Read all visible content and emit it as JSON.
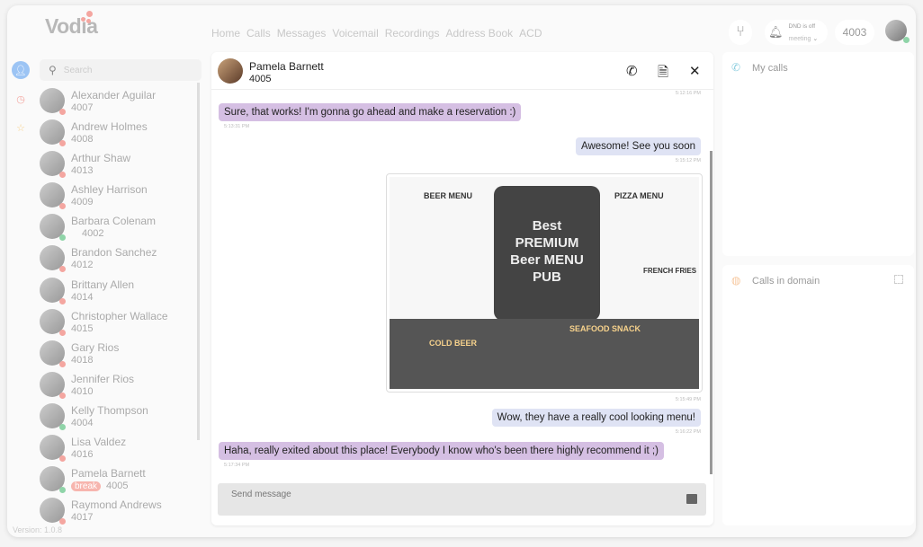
{
  "header": {
    "logo": "Vodia",
    "nav": [
      "Home",
      "Calls",
      "Messages",
      "Voicemail",
      "Recordings",
      "Address Book",
      "ACD"
    ],
    "dnd_status": "DND is off",
    "dnd_mode": "meeting",
    "extension": "4003"
  },
  "sidebar": {
    "search_placeholder": "Search",
    "version": "Version: 1.0.8",
    "contacts": [
      {
        "name": "Alexander Aguilar",
        "ext": "4007"
      },
      {
        "name": "Andrew Holmes",
        "ext": "4008"
      },
      {
        "name": "Arthur Shaw",
        "ext": "4013"
      },
      {
        "name": "Ashley Harrison",
        "ext": "4009"
      },
      {
        "name": "Barbara Colenam",
        "ext": "4002"
      },
      {
        "name": "Brandon Sanchez",
        "ext": "4012"
      },
      {
        "name": "Brittany Allen",
        "ext": "4014"
      },
      {
        "name": "Christopher Wallace",
        "ext": "4015"
      },
      {
        "name": "Gary Rios",
        "ext": "4018"
      },
      {
        "name": "Jennifer Rios",
        "ext": "4010"
      },
      {
        "name": "Kelly Thompson",
        "ext": "4004"
      },
      {
        "name": "Lisa Valdez",
        "ext": "4016"
      },
      {
        "name": "Pamela Barnett",
        "ext": "4005",
        "badge": "break"
      },
      {
        "name": "Raymond Andrews",
        "ext": "4017"
      }
    ]
  },
  "chat": {
    "name": "Pamela Barnett",
    "ext": "4005",
    "messages": [
      {
        "text": "Sure, that works! I'm gonna go ahead and make a reservation :)",
        "time": "5:13:31 PM"
      },
      {
        "text": "Awesome! See you soon",
        "time": "5:15:12 PM"
      },
      {
        "text": "Wow, they have a really cool looking menu!",
        "time": "5:16:22 PM"
      },
      {
        "text": "Haha, really exited about this place! Everybody I know who's been there highly recommend it ;)",
        "time": "5:17:34 PM"
      }
    ],
    "top_time": "5:12:16 PM",
    "image_time": "5:15:49 PM",
    "image_lettering": [
      "BEER MENU",
      "PIZZA MENU",
      "Best PREMIUM Beer MENU PUB",
      "FRENCH FRIES",
      "SEAFOOD SNACK",
      "COLD BEER"
    ],
    "compose_placeholder": "Send message"
  },
  "right": {
    "my_calls": "My calls",
    "calls_in_domain": "Calls in domain"
  },
  "colors": {
    "incoming_bubble": "#d5bfe3",
    "outgoing_bubble": "#dfe3f4",
    "accent": "#8ecfe0",
    "status_busy": "#f4a6a0",
    "status_online": "#8fd4a8"
  }
}
